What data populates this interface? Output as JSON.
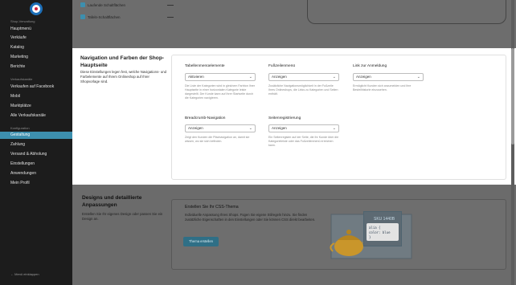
{
  "sidebar": {
    "section1": "Shop-Verwaltung",
    "items1": [
      "Hauptmenü",
      "Verkäufe",
      "Katalog",
      "Marketing",
      "Berichte"
    ],
    "section2": "Verkaufskanäle",
    "items2": [
      "Verkaufen auf Facebook",
      "Mobil",
      "Marktplätze",
      "Alle Verkaufskanäle"
    ],
    "section3": "Konfiguration",
    "items3": [
      "Gestaltung",
      "Zahlung",
      "Versand & Abholung",
      "Einstellungen",
      "Anwendungen",
      "Mein Profil"
    ],
    "footer": "← Menü einklappen"
  },
  "top": {
    "check1": "Laufende Schaltflächen",
    "check2": "Tafeln-Schaltflächen"
  },
  "nav_section": {
    "title": "Navigation und Farben der Shop-Hauptseite",
    "description": "Diese Einstellungen legen fest, welche Navigations- und Farbelemente auf Ihrem Onlineshop auf Ihrer Shopvorlage sind.",
    "fields": [
      {
        "label": "Tabellenmenüelemente",
        "value": "Aktivieren",
        "help": "Die Liste der Kategorien wird in gleichem Farbton Ihrer Hauptseite in einer horizontalen Kategorie leiste dargestellt. Der Kunde kann auf Ihrer Startseite durch die Kategorien navigieren."
      },
      {
        "label": "Fußzeilenmenü",
        "value": "Anzeigen",
        "help": "Zusätzliche Navigationsmöglichkeit in der Fußzeile Ihres Onlineshops, die Links zu Kategorien und Seiten enthält."
      },
      {
        "label": "Link zur Anmeldung",
        "value": "Anzeigen",
        "help": "Ermöglicht Kunden sich anzumelden und ihre Bestellhistorie einzusehen."
      },
      {
        "label": "Breadcrumb-Navigation",
        "value": "Anzeigen",
        "help": "Zeigt den Kunden die Pfadnavigation an, damit sie wissen, wo sie sich befinden."
      },
      {
        "label": "Seitenregistrierung",
        "value": "Anzeigen",
        "help": "Ein Seitenregister auf der Seite, die Ihr Kunde über die Kategorieleiste oder das Fußzeilenmenü erreichen kann."
      }
    ]
  },
  "design_section": {
    "title": "Designs und detaillierte Anpassungen",
    "description": "Erstellen Sie Ihr eigenes Design oder passen Sie ein Design an.",
    "css_card": {
      "title": "Erstellen Sie Ihr CSS-Thema",
      "description": "Individuelle Anpassung Ihres Shops. Fügen Sie eigene Stilregeln hinzu. Sie finden zusätzliche Eigenschaften in den Einstellungen oder Sie können CSS direkt bearbeiten.",
      "button": "Thema erstellen",
      "sku": "SKU 1440B",
      "code_line1": "alia {",
      "code_line2": "color: blue",
      "code_line3": "}"
    }
  }
}
